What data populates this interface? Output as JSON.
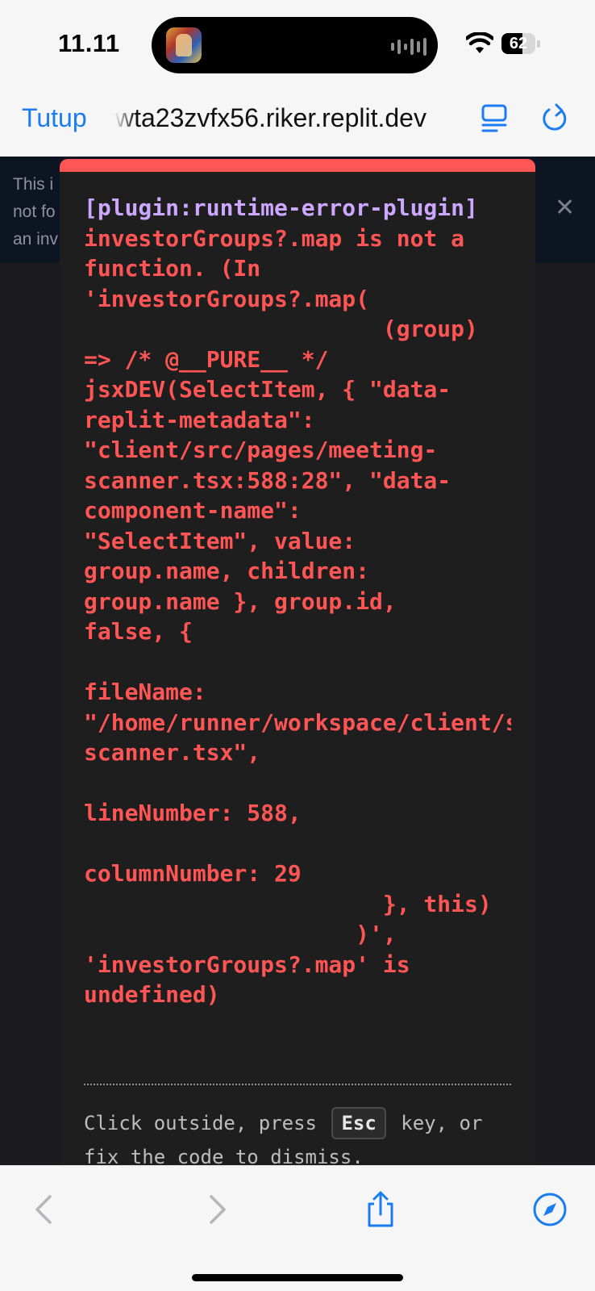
{
  "status_bar": {
    "time": "11.11",
    "battery_percent": "62",
    "battery_level": 0.62
  },
  "browser": {
    "close_label": "Tutup",
    "url": "wta23zvfx56.riker.replit.dev"
  },
  "banner": {
    "text": "This i\nnot fo\nan inv"
  },
  "error": {
    "plugin": "[plugin:runtime-error-plugin]",
    "message": "investorGroups?.map is not a\nfunction. (In\n'investorGroups?.map(\n                      (group)\n=> /* @__PURE__ */\njsxDEV(SelectItem, { \"data-\nreplit-metadata\":\n\"client/src/pages/meeting-\nscanner.tsx:588:28\", \"data-\ncomponent-name\":\n\"SelectItem\", value:\ngroup.name, children:\ngroup.name }, group.id,\nfalse, {\n\nfileName:\n\"/home/runner/workspace/client/src/pages/meeting-\nscanner.tsx\",\n\nlineNumber: 588,\n\ncolumnNumber: 29\n                      }, this)\n                    )',\n'investorGroups?.map' is\nundefined)",
    "dismiss_before": "Click outside, press ",
    "dismiss_key": "Esc",
    "dismiss_after": " key, or fix the code to dismiss."
  },
  "icons": {
    "back": "chevron-left-icon",
    "forward": "chevron-right-icon",
    "share": "share-icon",
    "compass": "compass-icon",
    "reader": "reader-mode-icon",
    "reload": "reload-icon",
    "wifi": "wifi-icon"
  },
  "colors": {
    "accent": "#1a7cf0",
    "error": "#ff5555",
    "plugin": "#cda6ff"
  }
}
